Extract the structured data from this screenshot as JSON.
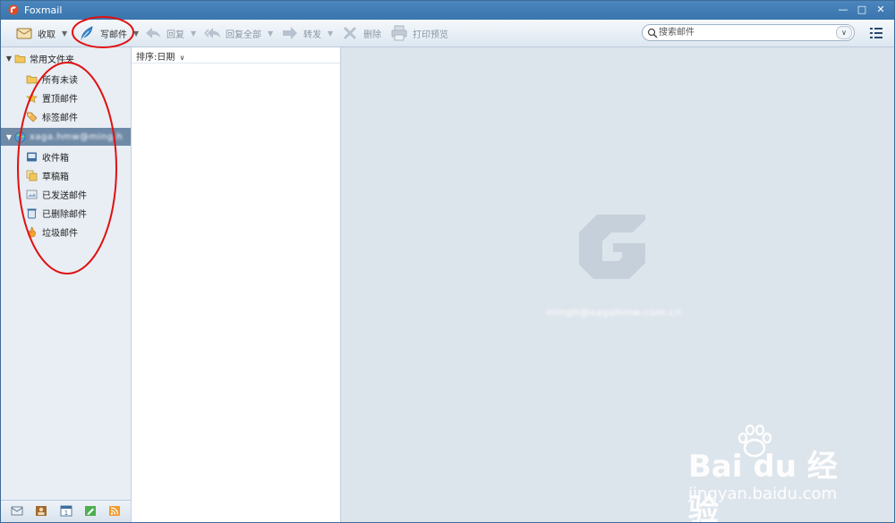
{
  "window": {
    "title": "Foxmail"
  },
  "toolbar": {
    "receive": "收取",
    "compose": "写邮件",
    "reply": "回复",
    "reply_all": "回复全部",
    "forward": "转发",
    "delete": "删除",
    "print_preview": "打印预览"
  },
  "search": {
    "placeholder": "搜索邮件"
  },
  "sidebar": {
    "common_folder": "常用文件夹",
    "common_items": [
      "所有未读",
      "置顶邮件",
      "标签邮件"
    ],
    "account": "xaga.hmw@ming.h",
    "account_items": [
      "收件箱",
      "草稿箱",
      "已发送邮件",
      "已删除邮件",
      "垃圾邮件"
    ]
  },
  "list": {
    "sort_label": "排序:日期"
  },
  "preview": {
    "account_email": "mingh@xagahmw.com.cn"
  },
  "watermark": {
    "main": "Bai du 经验",
    "sub": "jingyan.baidu.com"
  },
  "colors": {
    "titlebar": "#3a76ad",
    "selected_row": "#6f8aa7",
    "preview_bg": "#dde5ec",
    "annotation": "#e01010"
  }
}
